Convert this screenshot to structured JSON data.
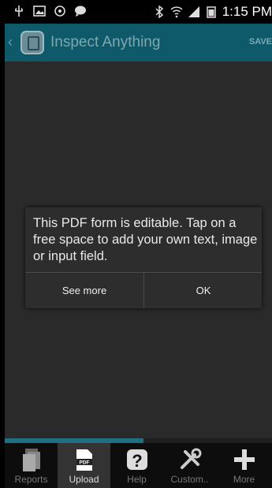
{
  "status_bar": {
    "time": "1:15 PM",
    "icons_left": [
      "usb-icon",
      "image-icon",
      "recycle-icon",
      "message-icon"
    ],
    "icons_right": [
      "bluetooth-icon",
      "wifi-icon",
      "signal-icon",
      "battery-icon"
    ]
  },
  "app_bar": {
    "title": "Inspect Anything",
    "save_label": "SAVE"
  },
  "dialog": {
    "message": "This PDF form is editable. Tap on a free space to add your own text, image or input field.",
    "see_more_label": "See more",
    "ok_label": "OK"
  },
  "progress": {
    "fraction": 0.52
  },
  "bottom_nav": {
    "items": [
      {
        "label": "Reports",
        "icon": "reports-icon"
      },
      {
        "label": "Upload",
        "icon": "pdf-upload-icon",
        "active": true
      },
      {
        "label": "Help",
        "icon": "help-icon"
      },
      {
        "label": "Custom..",
        "icon": "tools-icon"
      },
      {
        "label": "More",
        "icon": "plus-icon"
      }
    ]
  },
  "colors": {
    "app_bar": "#0e5a6b",
    "background": "#2a2a2a",
    "progress": "#1f6f82"
  }
}
